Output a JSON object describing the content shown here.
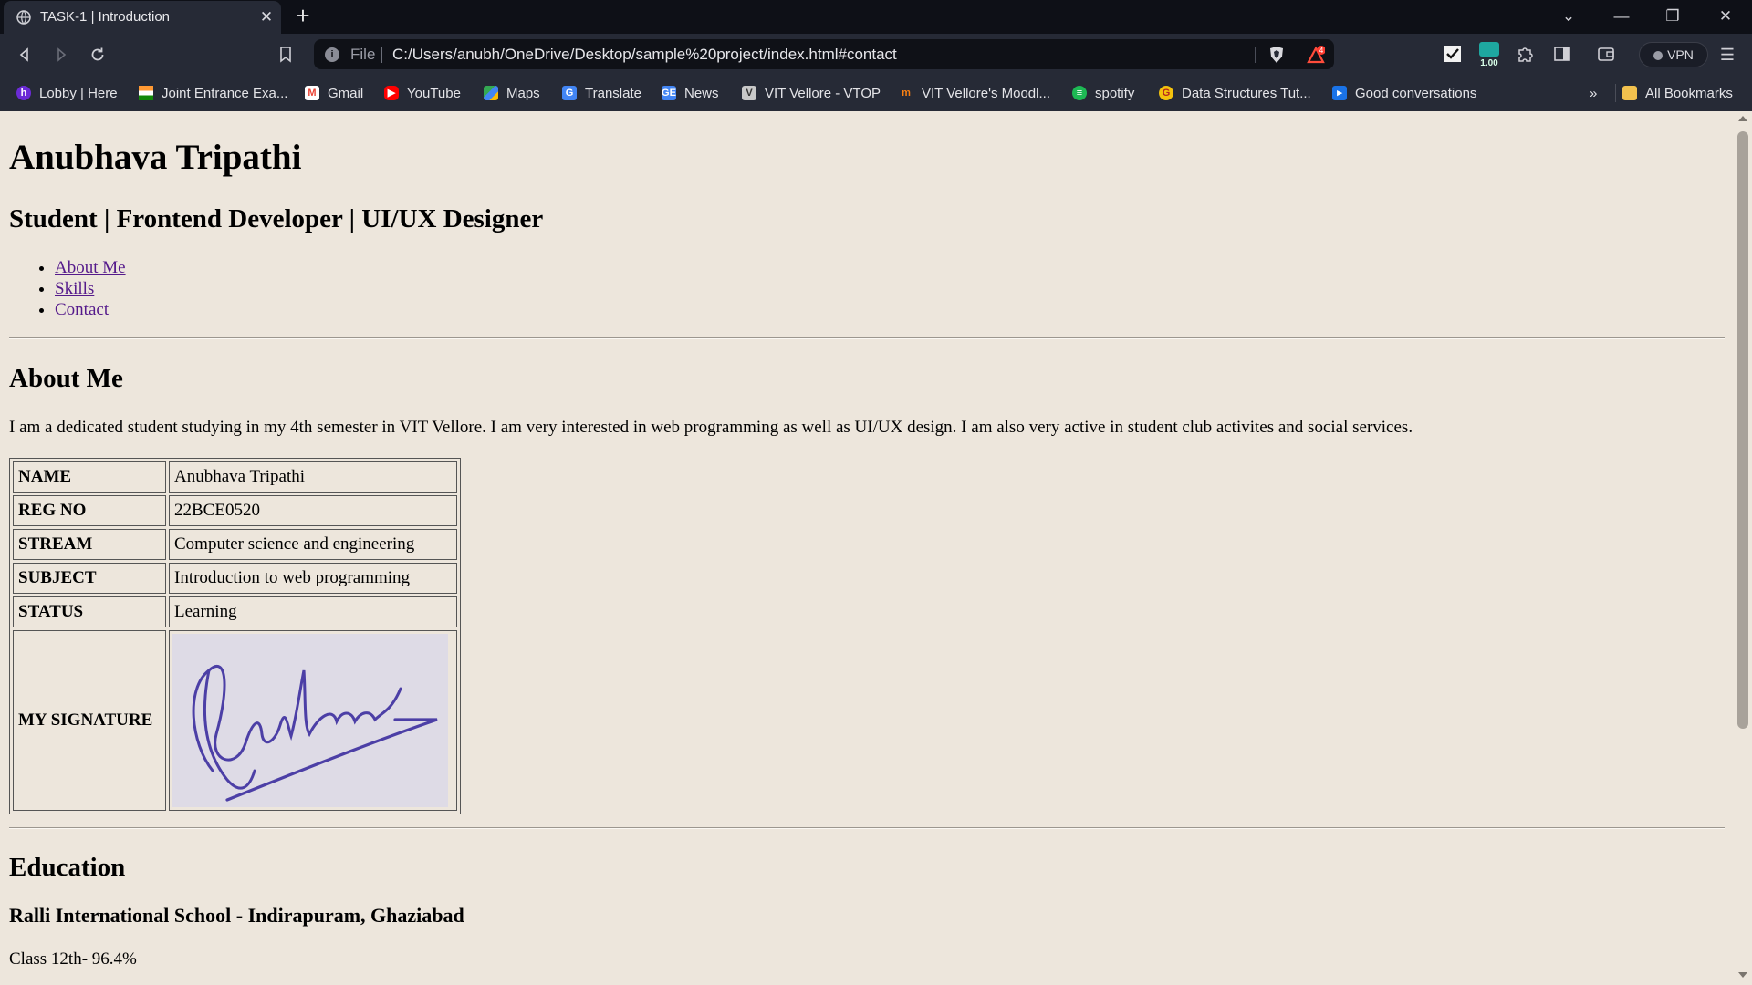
{
  "browser": {
    "tab_title": "TASK-1 | Introduction",
    "new_tab_symbol": "+",
    "url_scheme": "File",
    "url": "C:/Users/anubh/OneDrive/Desktop/sample%20project/index.html#contact",
    "rewards_badge": "4",
    "extension_badge": "1.00",
    "vpn_label": "VPN",
    "bookmarks": [
      {
        "label": "Lobby | Here",
        "icon": "h-icon",
        "color": "#6b2bd6"
      },
      {
        "label": "Joint Entrance Exa...",
        "icon": "india-flag-icon",
        "color": "#ff9933"
      },
      {
        "label": "Gmail",
        "icon": "gmail-icon",
        "color": "#ea4335"
      },
      {
        "label": "YouTube",
        "icon": "youtube-icon",
        "color": "#ff0000"
      },
      {
        "label": "Maps",
        "icon": "maps-icon",
        "color": "#34a853"
      },
      {
        "label": "Translate",
        "icon": "translate-icon",
        "color": "#4285f4"
      },
      {
        "label": "News",
        "icon": "news-icon",
        "color": "#4285f4"
      },
      {
        "label": "VIT Vellore - VTOP",
        "icon": "vtop-icon",
        "color": "#c8c8c8"
      },
      {
        "label": "VIT Vellore's Moodl...",
        "icon": "moodle-icon",
        "color": "#f98012"
      },
      {
        "label": "spotify",
        "icon": "spotify-icon",
        "color": "#1db954"
      },
      {
        "label": "Data Structures Tut...",
        "icon": "gfg-icon",
        "color": "#f4c20d"
      },
      {
        "label": "Good conversations",
        "icon": "video-icon",
        "color": "#1a73e8"
      }
    ],
    "bookmarks_overflow": "»",
    "all_bookmarks_label": "All Bookmarks"
  },
  "page": {
    "name": "Anubhava Tripathi",
    "role": "Student | Frontend Developer | UI/UX Designer",
    "nav": [
      "About Me",
      "Skills",
      "Contact"
    ],
    "about_heading": "About Me",
    "about_text": "I am a dedicated student studying in my 4th semester in VIT Vellore. I am very interested in web programming as well as UI/UX design. I am also very active in student club activites and social services.",
    "table": [
      {
        "key": "NAME",
        "value": "Anubhava Tripathi"
      },
      {
        "key": "REG NO",
        "value": "22BCE0520"
      },
      {
        "key": "STREAM",
        "value": "Computer science and engineering"
      },
      {
        "key": "SUBJECT",
        "value": "Introduction to web programming"
      },
      {
        "key": "STATUS",
        "value": "Learning"
      }
    ],
    "signature_label": "MY SIGNATURE",
    "signature_text": "Anubhava",
    "education_heading": "Education",
    "school": "Ralli International School - Indirapuram, Ghaziabad",
    "grade": "Class 12th- 96.4%"
  }
}
